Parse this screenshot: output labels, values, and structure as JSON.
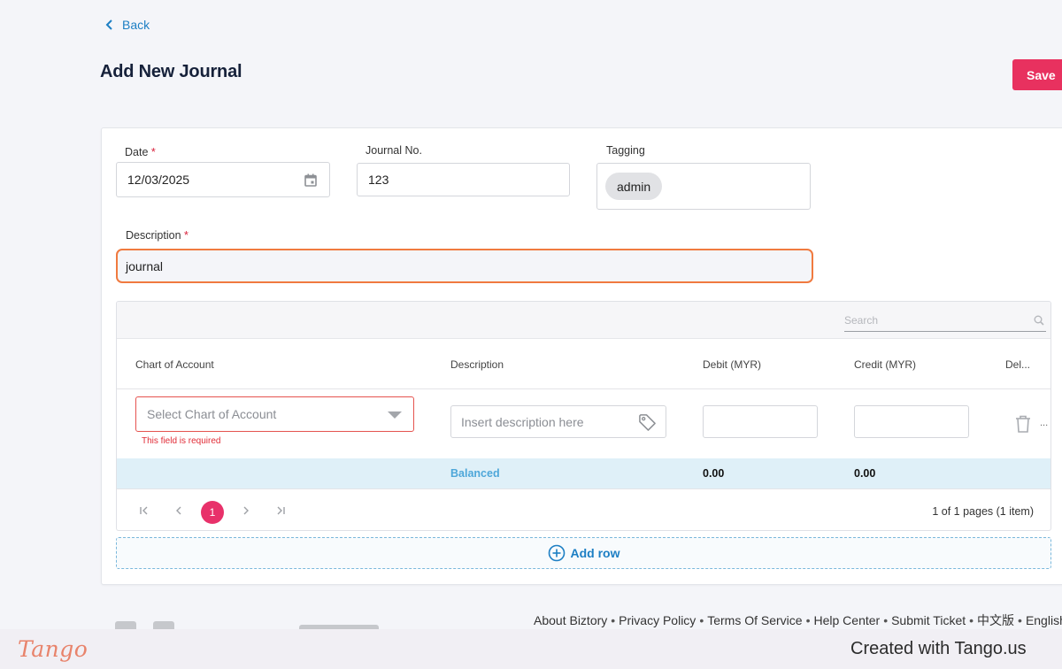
{
  "header": {
    "back_label": "Back",
    "title": "Add New Journal",
    "save_label": "Save"
  },
  "form": {
    "date_label": "Date",
    "date_value": "12/03/2025",
    "journal_no_label": "Journal No.",
    "journal_no_value": "123",
    "tagging_label": "Tagging",
    "tag_value": "admin",
    "description_label": "Description",
    "description_value": "journal",
    "required_marker": "*"
  },
  "grid": {
    "search_placeholder": "Search",
    "columns": [
      "Chart of Account",
      "Description",
      "Debit (MYR)",
      "Credit (MYR)",
      "Del..."
    ],
    "row": {
      "account_placeholder": "Select Chart of Account",
      "account_error": "This field is required",
      "description_placeholder": "Insert description here",
      "debit_value": "",
      "credit_value": "",
      "more": "..."
    },
    "summary": {
      "status": "Balanced",
      "debit_total": "0.00",
      "credit_total": "0.00"
    },
    "pagination": {
      "current_page": "1",
      "info": "1 of 1 pages (1 item)"
    },
    "add_row_label": "Add row"
  },
  "footer": {
    "links": [
      "About Biztory",
      "Privacy Policy",
      "Terms Of Service",
      "Help Center",
      "Submit Ticket",
      "中文版",
      "English"
    ],
    "separator": "•"
  },
  "tango": {
    "logo": "Tango",
    "created": "Created with Tango.us"
  },
  "colors": {
    "accent_pink": "#e8315f",
    "link_blue": "#1d7fc4",
    "focus_orange": "#f07a3f",
    "error_red": "#e12b36",
    "balanced_blue": "#4ea7d9"
  }
}
